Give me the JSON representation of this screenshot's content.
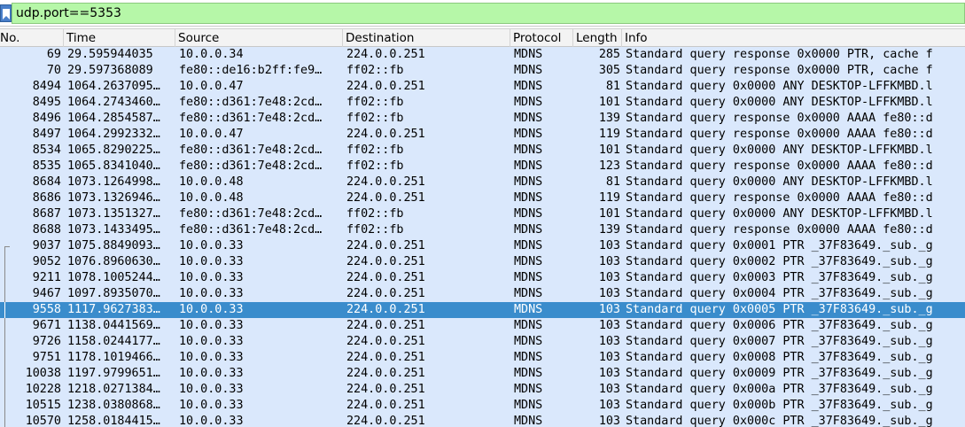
{
  "filter": {
    "value": "udp.port==5353",
    "icon": "bookmark-icon"
  },
  "colors": {
    "filter_ok": "#b6f7a8",
    "row_bg": "#dae8fc",
    "selected_bg": "#3a8ccc"
  },
  "columns": [
    "No.",
    "Time",
    "Source",
    "Destination",
    "Protocol",
    "Length",
    "Info"
  ],
  "selected_no": "9558",
  "packets": [
    {
      "no": "69",
      "time": "29.595944035",
      "src": "10.0.0.34",
      "dst": "224.0.0.251",
      "proto": "MDNS",
      "len": "285",
      "info": "Standard query response 0x0000 PTR, cache f"
    },
    {
      "no": "70",
      "time": "29.597368089",
      "src": "fe80::de16:b2ff:fe9…",
      "dst": "ff02::fb",
      "proto": "MDNS",
      "len": "305",
      "info": "Standard query response 0x0000 PTR, cache f"
    },
    {
      "no": "8494",
      "time": "1064.2637095…",
      "src": "10.0.0.47",
      "dst": "224.0.0.251",
      "proto": "MDNS",
      "len": "81",
      "info": "Standard query 0x0000 ANY DESKTOP-LFFKMBD.l"
    },
    {
      "no": "8495",
      "time": "1064.2743460…",
      "src": "fe80::d361:7e48:2cd…",
      "dst": "ff02::fb",
      "proto": "MDNS",
      "len": "101",
      "info": "Standard query 0x0000 ANY DESKTOP-LFFKMBD.l"
    },
    {
      "no": "8496",
      "time": "1064.2854587…",
      "src": "fe80::d361:7e48:2cd…",
      "dst": "ff02::fb",
      "proto": "MDNS",
      "len": "139",
      "info": "Standard query response 0x0000 AAAA fe80::d"
    },
    {
      "no": "8497",
      "time": "1064.2992332…",
      "src": "10.0.0.47",
      "dst": "224.0.0.251",
      "proto": "MDNS",
      "len": "119",
      "info": "Standard query response 0x0000 AAAA fe80::d"
    },
    {
      "no": "8534",
      "time": "1065.8290225…",
      "src": "fe80::d361:7e48:2cd…",
      "dst": "ff02::fb",
      "proto": "MDNS",
      "len": "101",
      "info": "Standard query 0x0000 ANY DESKTOP-LFFKMBD.l"
    },
    {
      "no": "8535",
      "time": "1065.8341040…",
      "src": "fe80::d361:7e48:2cd…",
      "dst": "ff02::fb",
      "proto": "MDNS",
      "len": "123",
      "info": "Standard query response 0x0000 AAAA fe80::d"
    },
    {
      "no": "8684",
      "time": "1073.1264998…",
      "src": "10.0.0.48",
      "dst": "224.0.0.251",
      "proto": "MDNS",
      "len": "81",
      "info": "Standard query 0x0000 ANY DESKTOP-LFFKMBD.l"
    },
    {
      "no": "8686",
      "time": "1073.1326946…",
      "src": "10.0.0.48",
      "dst": "224.0.0.251",
      "proto": "MDNS",
      "len": "119",
      "info": "Standard query response 0x0000 AAAA fe80::d"
    },
    {
      "no": "8687",
      "time": "1073.1351327…",
      "src": "fe80::d361:7e48:2cd…",
      "dst": "ff02::fb",
      "proto": "MDNS",
      "len": "101",
      "info": "Standard query 0x0000 ANY DESKTOP-LFFKMBD.l"
    },
    {
      "no": "8688",
      "time": "1073.1433495…",
      "src": "fe80::d361:7e48:2cd…",
      "dst": "ff02::fb",
      "proto": "MDNS",
      "len": "139",
      "info": "Standard query response 0x0000 AAAA fe80::d"
    },
    {
      "no": "9037",
      "time": "1075.8849093…",
      "src": "10.0.0.33",
      "dst": "224.0.0.251",
      "proto": "MDNS",
      "len": "103",
      "info": "Standard query 0x0001 PTR _37F83649._sub._g"
    },
    {
      "no": "9052",
      "time": "1076.8960630…",
      "src": "10.0.0.33",
      "dst": "224.0.0.251",
      "proto": "MDNS",
      "len": "103",
      "info": "Standard query 0x0002 PTR _37F83649._sub._g"
    },
    {
      "no": "9211",
      "time": "1078.1005244…",
      "src": "10.0.0.33",
      "dst": "224.0.0.251",
      "proto": "MDNS",
      "len": "103",
      "info": "Standard query 0x0003 PTR _37F83649._sub._g"
    },
    {
      "no": "9467",
      "time": "1097.8935070…",
      "src": "10.0.0.33",
      "dst": "224.0.0.251",
      "proto": "MDNS",
      "len": "103",
      "info": "Standard query 0x0004 PTR _37F83649._sub._g"
    },
    {
      "no": "9558",
      "time": "1117.9627383…",
      "src": "10.0.0.33",
      "dst": "224.0.0.251",
      "proto": "MDNS",
      "len": "103",
      "info": "Standard query 0x0005 PTR _37F83649._sub._g"
    },
    {
      "no": "9671",
      "time": "1138.0441569…",
      "src": "10.0.0.33",
      "dst": "224.0.0.251",
      "proto": "MDNS",
      "len": "103",
      "info": "Standard query 0x0006 PTR _37F83649._sub._g"
    },
    {
      "no": "9726",
      "time": "1158.0244177…",
      "src": "10.0.0.33",
      "dst": "224.0.0.251",
      "proto": "MDNS",
      "len": "103",
      "info": "Standard query 0x0007 PTR _37F83649._sub._g"
    },
    {
      "no": "9751",
      "time": "1178.1019466…",
      "src": "10.0.0.33",
      "dst": "224.0.0.251",
      "proto": "MDNS",
      "len": "103",
      "info": "Standard query 0x0008 PTR _37F83649._sub._g"
    },
    {
      "no": "10038",
      "time": "1197.9799651…",
      "src": "10.0.0.33",
      "dst": "224.0.0.251",
      "proto": "MDNS",
      "len": "103",
      "info": "Standard query 0x0009 PTR _37F83649._sub._g"
    },
    {
      "no": "10228",
      "time": "1218.0271384…",
      "src": "10.0.0.33",
      "dst": "224.0.0.251",
      "proto": "MDNS",
      "len": "103",
      "info": "Standard query 0x000a PTR _37F83649._sub._g"
    },
    {
      "no": "10515",
      "time": "1238.0380868…",
      "src": "10.0.0.33",
      "dst": "224.0.0.251",
      "proto": "MDNS",
      "len": "103",
      "info": "Standard query 0x000b PTR _37F83649._sub._g"
    },
    {
      "no": "10570",
      "time": "1258.0184415…",
      "src": "10.0.0.33",
      "dst": "224.0.0.251",
      "proto": "MDNS",
      "len": "103",
      "info": "Standard query 0x000c PTR _37F83649._sub._g"
    }
  ]
}
